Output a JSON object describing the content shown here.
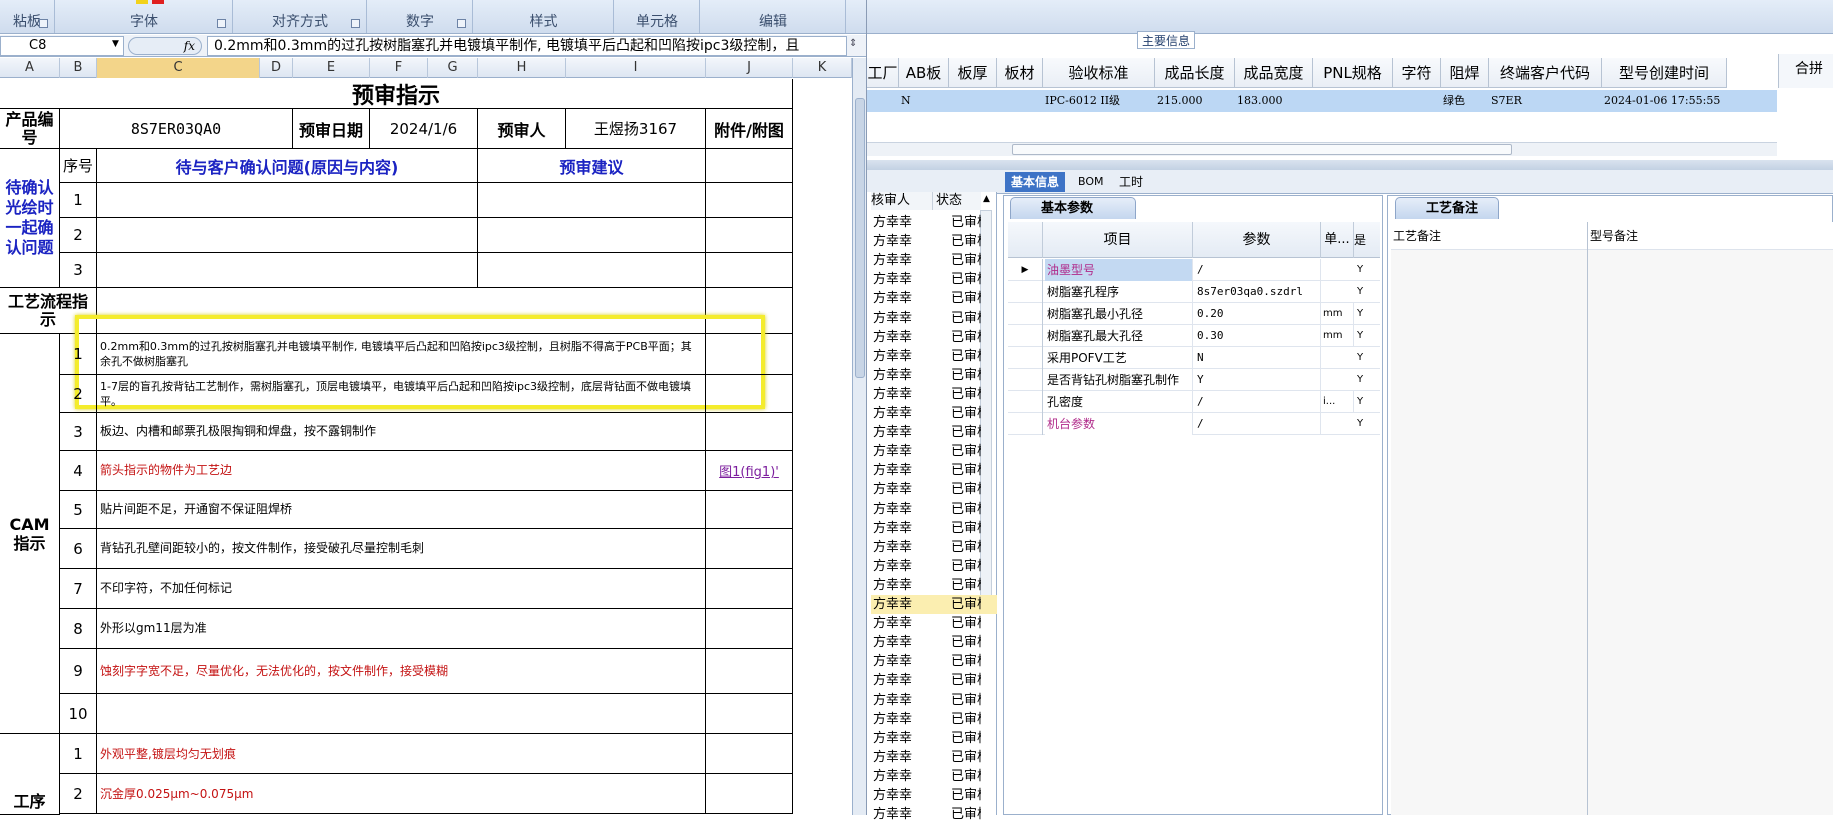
{
  "ribbon": {
    "groups": [
      "粘板",
      "字体",
      "对齐方式",
      "数字",
      "样式",
      "单元格",
      "编辑"
    ]
  },
  "formula_bar": {
    "name_box": "C8",
    "fx": "fx",
    "content": "0.2mm和0.3mm的过孔按树脂塞孔并电镀填平制作, 电镀填平后凸起和凹陷按ipc3级控制，且"
  },
  "columns": [
    "A",
    "B",
    "C",
    "D",
    "E",
    "F",
    "G",
    "H",
    "I",
    "J",
    "K"
  ],
  "sheet": {
    "title": "预审指示",
    "product_label": "产品编号",
    "product_code": "8S7ER03QA0",
    "date_label": "预审日期",
    "date": "2024/1/6",
    "reviewer_label": "预审人",
    "reviewer": "王煜扬3167",
    "attach_label": "附件/附图",
    "seq_label": "序号",
    "issue_header": "待与客户确认问题(原因与内容)",
    "advice_header": "预审建议",
    "confirm_label": "待确认光绘时一起确认问题",
    "confirm_rows": [
      "1",
      "2",
      "3"
    ],
    "process_label": "工艺流程指示",
    "cam_label": "CAM指示",
    "cam_rows": [
      {
        "no": "1",
        "text": "0.2mm和0.3mm的过孔按树脂塞孔并电镀填平制作, 电镀填平后凸起和凹陷按ipc3级控制，且树脂不得高于PCB平面；其余孔不做树脂塞孔",
        "red": false
      },
      {
        "no": "2",
        "text": "1-7层的盲孔按背钻工艺制作，需树脂塞孔，顶层电镀填平，电镀填平后凸起和凹陷按ipc3级控制，底层背钻面不做电镀填平。",
        "red": false
      },
      {
        "no": "3",
        "text": "板边、内槽和邮票孔极限掏铜和焊盘，按不露铜制作",
        "red": false
      },
      {
        "no": "4",
        "text": "箭头指示的物件为工艺边",
        "red": true
      },
      {
        "no": "5",
        "text": "贴片间距不足，开通窗不保证阻焊桥",
        "red": false
      },
      {
        "no": "6",
        "text": "背钻孔孔壁间距较小的，按文件制作，接受破孔尽量控制毛刺",
        "red": false
      },
      {
        "no": "7",
        "text": "不印字符，不加任何标记",
        "red": false
      },
      {
        "no": "8",
        "text": "外形以gm11层为准",
        "red": false
      },
      {
        "no": "9",
        "text": "蚀刻字字宽不足，尽量优化，无法优化的，按文件制作，接受模糊",
        "red": true
      },
      {
        "no": "10",
        "text": "",
        "red": false
      }
    ],
    "fig_link": "图1(fig1)'",
    "process_rows": [
      {
        "no": "1",
        "text": "外观平整,镀层均匀无划痕",
        "red": true
      },
      {
        "no": "2",
        "text": "沉金厚0.025μm~0.075μm",
        "red": true
      }
    ],
    "process_partial_label": "工序"
  },
  "main_info": {
    "title": "主要信息",
    "headers": [
      "工厂",
      "AB板",
      "板厚",
      "板材",
      "验收标准",
      "成品长度",
      "成品宽度",
      "PNL规格",
      "字符",
      "阻焊",
      "终端客户代码",
      "型号创建时间"
    ],
    "row": [
      "",
      "N",
      "",
      "",
      "IPC-6012 II级",
      "215.000",
      "183.000",
      "",
      "",
      "绿色",
      "S7ER",
      "2024-01-06 17:55:55"
    ],
    "side_header": "合拼"
  },
  "tabs": [
    "基本信息",
    "BOM",
    "工时"
  ],
  "reviewer_list": {
    "headers": [
      "核审人",
      "状态"
    ],
    "name": "方幸幸",
    "status": "已审核",
    "count": 32
  },
  "basic_params": {
    "tab": "基本参数",
    "headers": [
      "项目",
      "参数",
      "单...",
      "是"
    ],
    "rows": [
      {
        "item": "油墨型号",
        "value": "/",
        "unit": "",
        "flag": "Y",
        "pink": true
      },
      {
        "item": "树脂塞孔程序",
        "value": "8s7er03qa0.szdrl",
        "unit": "",
        "flag": "Y",
        "pink": false
      },
      {
        "item": "树脂塞孔最小孔径",
        "value": "0.20",
        "unit": "mm",
        "flag": "Y",
        "pink": false
      },
      {
        "item": "树脂塞孔最大孔径",
        "value": "0.30",
        "unit": "mm",
        "flag": "Y",
        "pink": false
      },
      {
        "item": "采用POFV工艺",
        "value": "N",
        "unit": "",
        "flag": "Y",
        "pink": false
      },
      {
        "item": "是否背钻孔树脂塞孔制作",
        "value": "Y",
        "unit": "",
        "flag": "Y",
        "pink": false
      },
      {
        "item": "孔密度",
        "value": "/",
        "unit": "i...",
        "flag": "Y",
        "pink": false
      },
      {
        "item": "机台参数",
        "value": "/",
        "unit": "",
        "flag": "Y",
        "pink": true
      }
    ]
  },
  "process_notes": {
    "tab": "工艺备注",
    "col1": "工艺备注",
    "col2": "型号备注"
  }
}
